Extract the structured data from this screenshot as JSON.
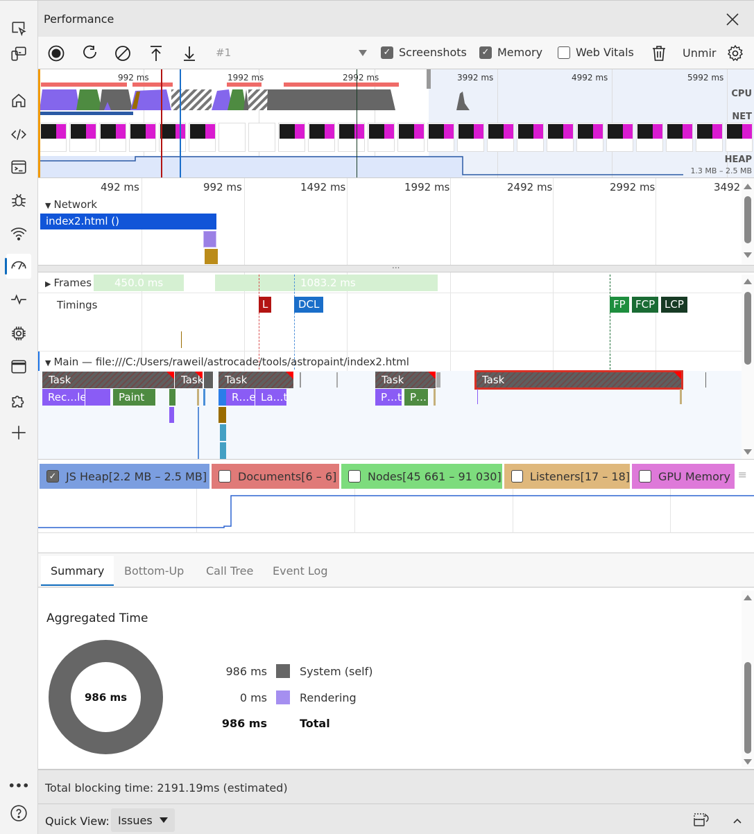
{
  "activity_bar": {
    "items": [
      {
        "name": "inspect",
        "icon": "inspect-element-icon"
      },
      {
        "name": "device-emulation",
        "icon": "device-emulation-icon"
      },
      {
        "name": "welcome",
        "icon": "home-icon"
      },
      {
        "name": "elements",
        "icon": "code-icon"
      },
      {
        "name": "console",
        "icon": "console-icon"
      },
      {
        "name": "sources",
        "icon": "bug-icon"
      },
      {
        "name": "network",
        "icon": "wifi-icon"
      },
      {
        "name": "performance",
        "icon": "speedometer-icon",
        "active": true
      },
      {
        "name": "memory",
        "icon": "pulse-icon"
      },
      {
        "name": "application",
        "icon": "chip-icon"
      },
      {
        "name": "browser-window",
        "icon": "window-icon"
      },
      {
        "name": "extensions",
        "icon": "puzzle-icon"
      },
      {
        "name": "more-tools",
        "icon": "plus-icon"
      }
    ],
    "more_label": "•••",
    "help_label": "?"
  },
  "panel": {
    "title": "Performance",
    "close_icon": "close-icon"
  },
  "toolbar": {
    "recording_id": "#1",
    "checkboxes": [
      {
        "label": "Screenshots",
        "checked": true
      },
      {
        "label": "Memory",
        "checked": true
      },
      {
        "label": "Web Vitals",
        "checked": false
      }
    ],
    "truncated_label": "Unmir"
  },
  "overview": {
    "ticks": [
      "992 ms",
      "1992 ms",
      "2992 ms",
      "3992 ms",
      "4992 ms",
      "5992 ms"
    ],
    "labels": {
      "cpu": "CPU",
      "net": "NET",
      "heap": "HEAP"
    },
    "heap_range": "1.3 MB – 2.5 MB"
  },
  "timeline": {
    "ticks": [
      "492 ms",
      "992 ms",
      "1492 ms",
      "1992 ms",
      "2492 ms",
      "2992 ms",
      "3492"
    ],
    "network": {
      "header": "Network",
      "request": "index2.html ()"
    },
    "frames": {
      "header": "Frames",
      "durations": [
        "450.0 ms",
        "1083.2 ms"
      ]
    },
    "timings": {
      "header": "Timings",
      "markers": [
        {
          "label": "L",
          "color": "#b31412"
        },
        {
          "label": "DCL",
          "color": "#1a6ec9"
        },
        {
          "label": "FP",
          "color": "#1e8e3e"
        },
        {
          "label": "FCP",
          "color": "#1a6b34"
        },
        {
          "label": "LCP",
          "color": "#173a24"
        }
      ]
    },
    "main": {
      "header": "Main — file:///C:/Users/raweil/astrocade/tools/astropaint/index2.html",
      "tasks": [
        "Task",
        "Task",
        "Task",
        "Task",
        "Task"
      ],
      "events": [
        "Rec…le",
        "Paint",
        "R…e",
        "La…t",
        "P…t",
        "P…"
      ]
    }
  },
  "counters": [
    {
      "label": "JS Heap[2.2 MB – 2.5 MB]",
      "checked": true,
      "color": "#7b9ee0"
    },
    {
      "label": "Documents[6 – 6]",
      "checked": false,
      "color": "#e07a78"
    },
    {
      "label": "Nodes[45 661 – 91 030]",
      "checked": false,
      "color": "#7ddc7d"
    },
    {
      "label": "Listeners[17 – 18]",
      "checked": false,
      "color": "#dfb87c"
    },
    {
      "label": "GPU Memory",
      "checked": false,
      "color": "#de79d9"
    }
  ],
  "details": {
    "tabs": [
      "Summary",
      "Bottom-Up",
      "Call Tree",
      "Event Log"
    ],
    "active_tab": "Summary",
    "summary": {
      "title": "Aggregated Time",
      "center_label": "986 ms",
      "rows": [
        {
          "value": "986 ms",
          "label": "System (self)",
          "color": "#666666"
        },
        {
          "value": "0 ms",
          "label": "Rendering",
          "color": "#a58ff0"
        }
      ],
      "total": {
        "value": "986 ms",
        "label": "Total"
      }
    }
  },
  "status": {
    "total_blocking_time": "Total blocking time: 2191.19ms (estimated)"
  },
  "quick_view": {
    "label": "Quick View:",
    "selected": "Issues"
  }
}
